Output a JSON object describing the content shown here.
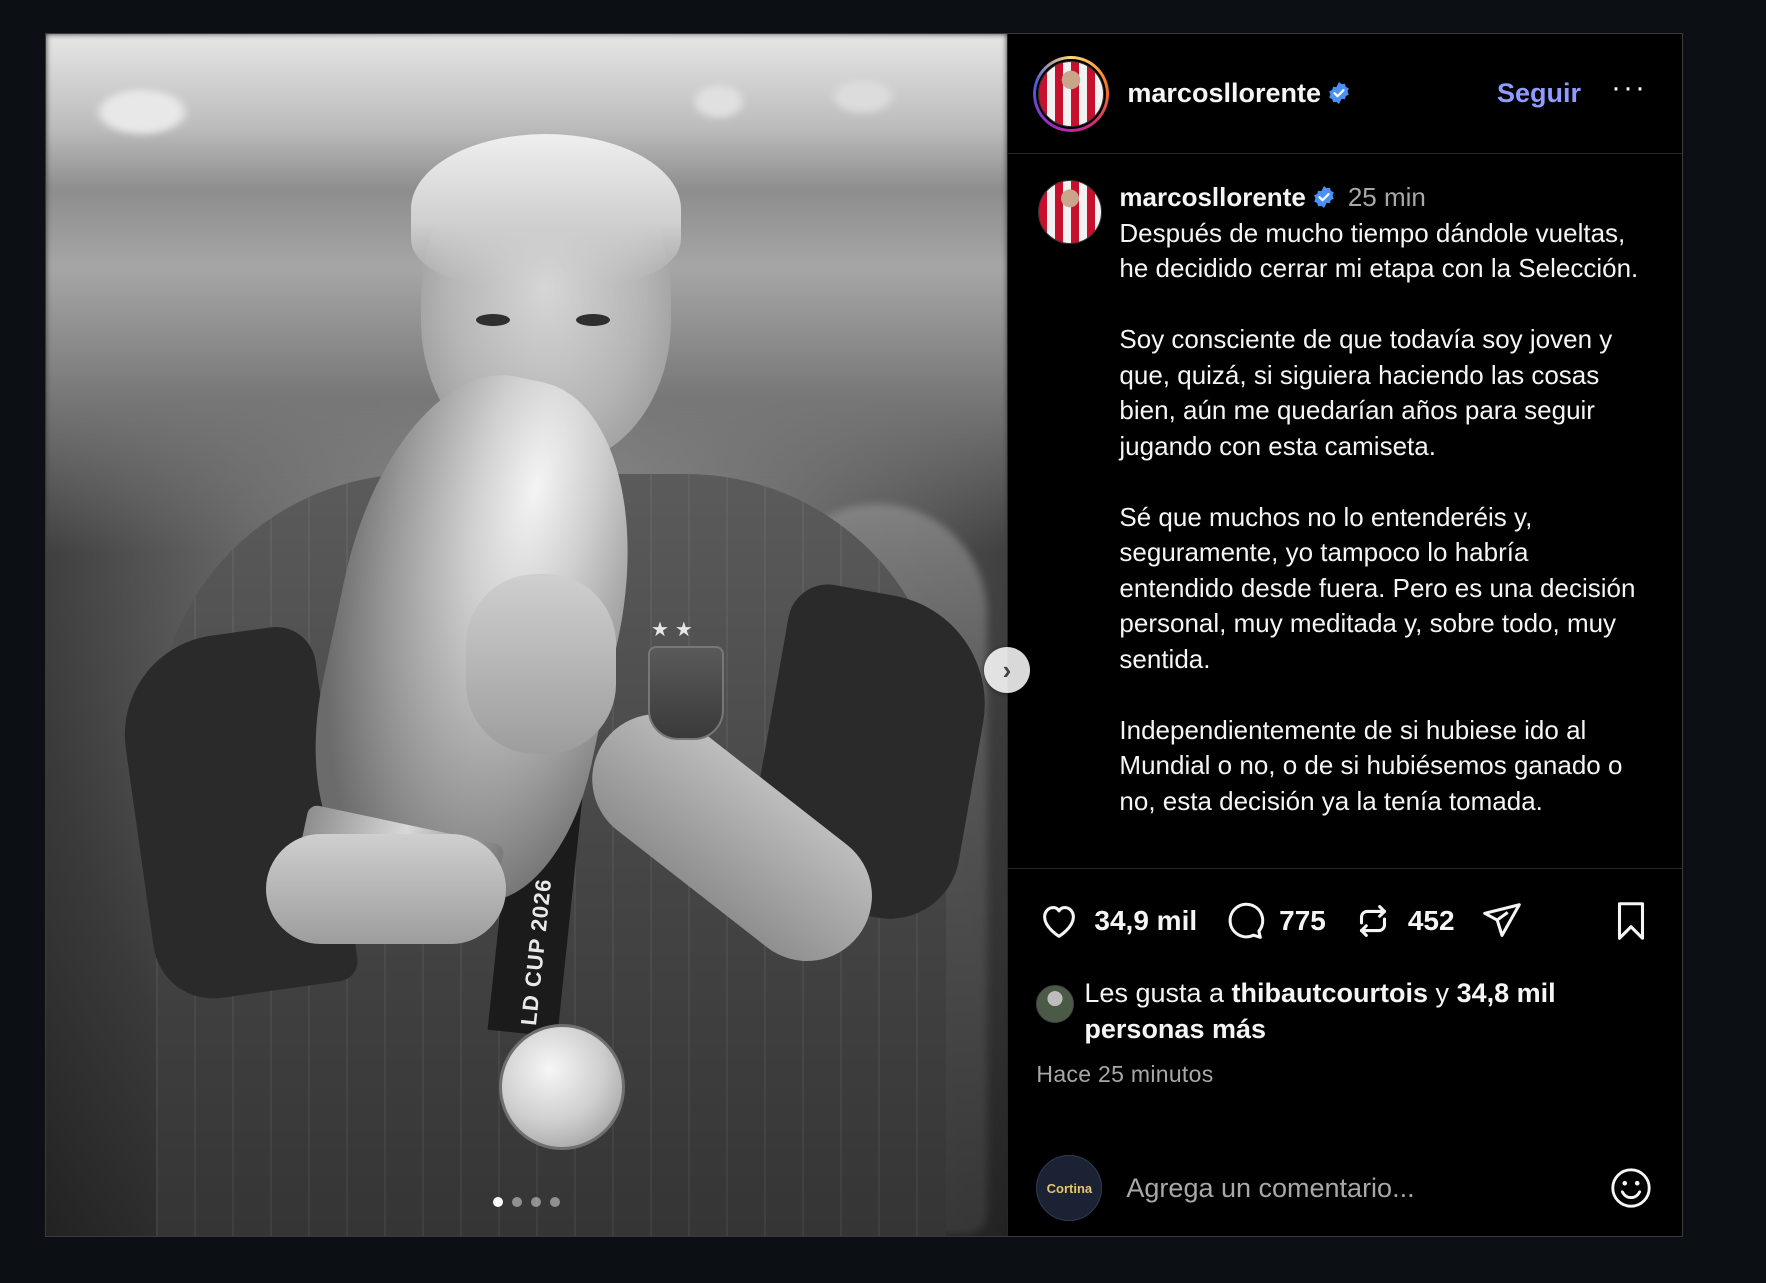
{
  "post": {
    "username": "marcosllorente",
    "follow_label": "Seguir",
    "more_label": "···",
    "time_short": "25 min",
    "caption_paragraphs": [
      "Después de mucho tiempo dándole vueltas, he decidido cerrar mi etapa con la Selección.",
      "Soy consciente de que todavía soy joven y que, quizá, si siguiera haciendo las cosas bien, aún me quedarían años para seguir jugando con esta camiseta.",
      "Sé que muchos no lo entenderéis y, seguramente, yo tampoco lo habría entendido desde fuera. Pero es una decisión personal, muy meditada y, sobre todo, muy sentida.",
      "Independientemente de si hubiese ido al Mundial o no, o de si hubiésemos ganado o no, esta decisión ya la tenía tomada."
    ]
  },
  "photo": {
    "lanyard_text": "LD CUP 2026",
    "carousel_count": 4,
    "carousel_active": 0,
    "next_glyph": "›"
  },
  "actions": {
    "likes": "34,9 mil",
    "comments": "775",
    "reposts": "452"
  },
  "likes_line": {
    "prefix": "Les gusta a",
    "user": "thibautcourtois",
    "mid": "y",
    "rest": "34,8 mil personas más"
  },
  "timestamp": "Hace 25 minutos",
  "comment": {
    "placeholder": "Agrega un comentario...",
    "brand_avatar_text": "Cortina"
  },
  "icons": [
    "verified-icon",
    "heart-icon",
    "comment-icon",
    "repost-icon",
    "share-icon",
    "bookmark-icon",
    "emoji-icon"
  ],
  "colors": {
    "background": "#0c1014",
    "panel": "#000000",
    "follow": "#8f9cff",
    "verified": "#4a90f5",
    "muted": "#a8a8a8"
  }
}
